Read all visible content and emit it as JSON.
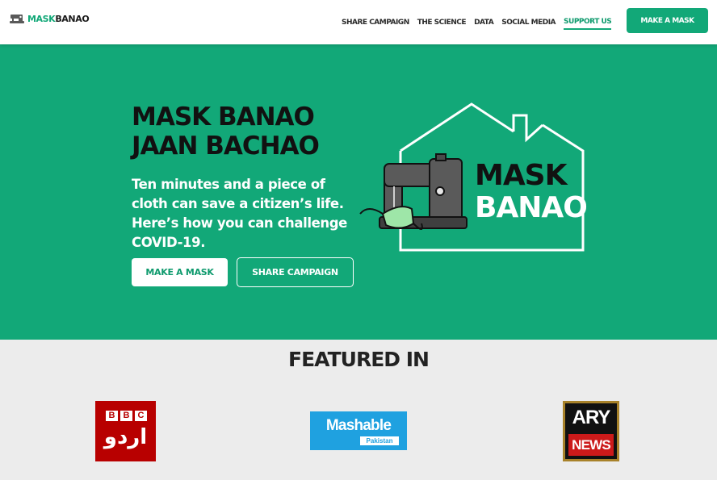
{
  "colors": {
    "brand_green": "#12a878",
    "bbc_red": "#b80000",
    "mashable_blue": "#1fa1e0",
    "ary_red": "#cc1a1a"
  },
  "nav": {
    "logo": {
      "part1": "MASK",
      "part2": "BANAO",
      "icon": "sewing-machine-icon"
    },
    "links": [
      "SHARE CAMPAIGN",
      "THE SCIENCE",
      "DATA",
      "SOCIAL MEDIA",
      "SUPPORT US"
    ],
    "active_link": "SUPPORT US",
    "cta": "MAKE A MASK"
  },
  "hero": {
    "title_line1": "MASK BANAO",
    "title_line2": "JAAN BACHAO",
    "subtitle": "Ten minutes and a piece of cloth can save a citizen’s life. Here’s how you can challenge COVID-19.",
    "primary_button": "MAKE A MASK",
    "secondary_button": "SHARE CAMPAIGN",
    "art": {
      "word1": "MASK",
      "word2": "BANAO",
      "icon": "sewing-machine-house-icon"
    }
  },
  "featured": {
    "title": "FEATURED IN",
    "logos": [
      {
        "name": "BBC Urdu",
        "letters": [
          "B",
          "B",
          "C"
        ],
        "script": "اردو"
      },
      {
        "name": "Mashable Pakistan",
        "word": "Mashable",
        "region": "Pakistan"
      },
      {
        "name": "ARY News",
        "top": "ARY",
        "bottom": "NEWS"
      }
    ]
  }
}
